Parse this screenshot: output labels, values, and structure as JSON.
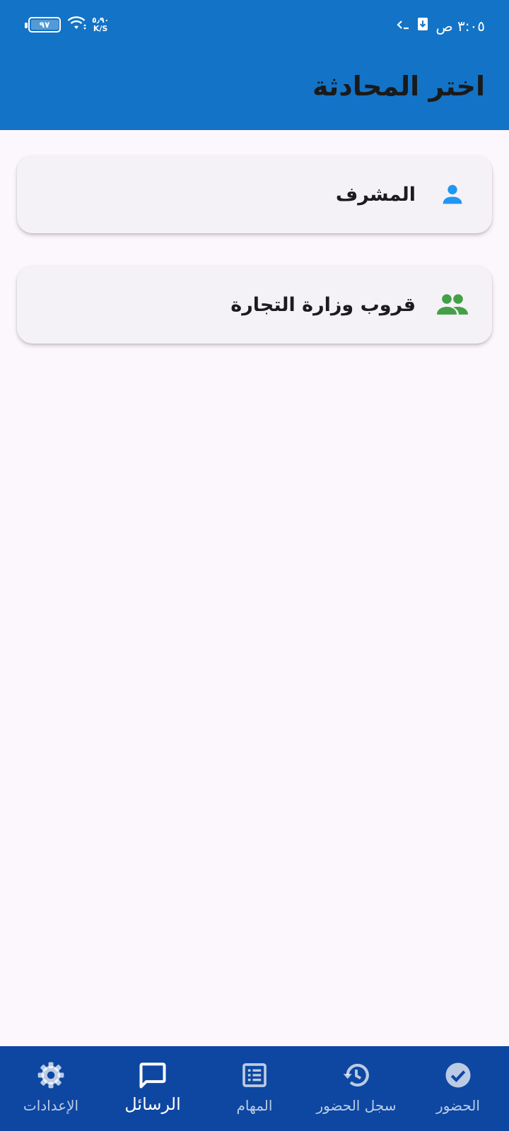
{
  "status_bar": {
    "time": "٣:٠٥ ص",
    "battery_percent": "٩٧",
    "battery_level": 0.97,
    "net_speed_value": "٥٫٩٠",
    "net_speed_unit": "K/S"
  },
  "appbar": {
    "title": "اختر المحادثة"
  },
  "chats": [
    {
      "label": "المشرف",
      "icon": "person-icon",
      "icon_color": "#2196f3"
    },
    {
      "label": "قروب وزارة التجارة",
      "icon": "group-icon",
      "icon_color": "#43a047"
    }
  ],
  "bottom_nav": {
    "active_index": 3,
    "items": [
      {
        "label": "الحضور",
        "icon": "check-circle-icon"
      },
      {
        "label": "سجل الحضور",
        "icon": "history-icon"
      },
      {
        "label": "المهام",
        "icon": "list-alt-icon"
      },
      {
        "label": "الرسائل",
        "icon": "chat-bubble-icon"
      },
      {
        "label": "الإعدادات",
        "icon": "gear-icon"
      }
    ]
  },
  "colors": {
    "appbar": "#1373c6",
    "bottom_nav": "#0d47a1",
    "background": "#fcf6fd",
    "card": "#f5f2f7"
  }
}
